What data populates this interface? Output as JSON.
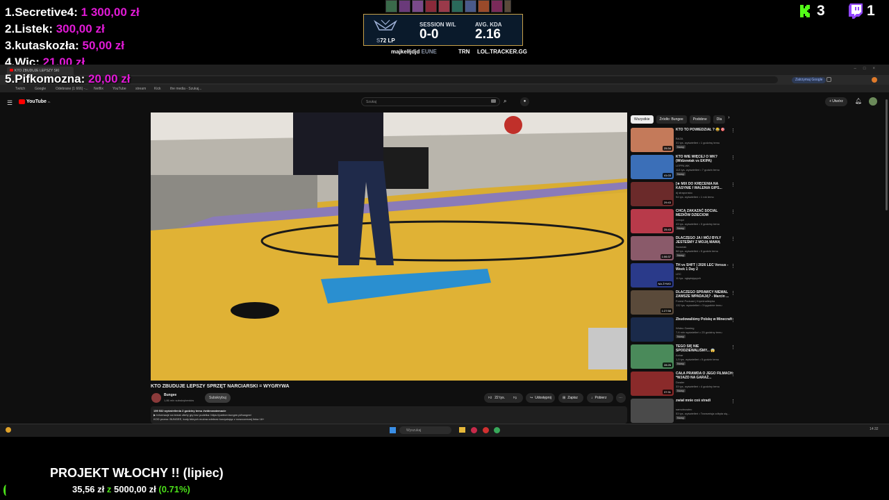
{
  "donations": [
    {
      "rank": "1.",
      "name": "Secretive4:",
      "amount": "1 300,00 zł"
    },
    {
      "rank": "2.",
      "name": "Listek:",
      "amount": "300,00 zł"
    },
    {
      "rank": "3.",
      "name": "kutaskozła:",
      "amount": "50,00 zł"
    },
    {
      "rank": "4.",
      "name": "Wic:",
      "amount": "21,00 zł"
    },
    {
      "rank": "5.",
      "name": "Pifkomozna:",
      "amount": "20,00 zł"
    }
  ],
  "platform_counts": {
    "kick": "3",
    "twitch": "1"
  },
  "hud": {
    "lp": "72 LP",
    "lp_prefix": "S",
    "session_label": "SESSION W/L",
    "session_value": "0-0",
    "kda_label": "AVG. KDA",
    "kda_value": "2.16",
    "summoner": "majkelłjdjd",
    "region": "EUNE",
    "trn": "TRN",
    "tracker": "LOL.TRACKER.GG"
  },
  "browser": {
    "tab_title": "KTO ZBUDUJE LEPSZY SKI",
    "bookmarks": [
      "Twitch",
      "Google",
      "Odebrane (1 666) -...",
      "Netflix",
      "YouTube",
      "stream",
      "Kick",
      "the media - Szukaj..."
    ],
    "profile_badge": "Zatrzymaj Google"
  },
  "youtube": {
    "logo": "YouTube",
    "logo_sup": "PL",
    "search_placeholder": "Szukaj",
    "create_label": "+ Utwórz",
    "video_title": "KTO ZBUDUJE LEPSZY SPRZĘT NARCIARSKI = WYGRYWA",
    "channel_name": "Bungee",
    "subscribers": "1,86 mln subskrybentów",
    "subscribe_label": "Subskrybuj",
    "likes": "22 tys.",
    "share_label": "Udostępnij",
    "save_label": "Zapisz",
    "download_label": "Pobierz",
    "description_line1": "159 532 wyświetlenia  2 godziny temu  #wideonatemacie",
    "description_line2": "▶ Informacje na temat oferty gry bez pudełka: https://partner.bungee.pl/bungee/",
    "description_line3": "KOD promo: BUNGEE, kody których można odebrać korzystając z nowoczesnej linka 18+",
    "chips": [
      "Wszystkie",
      "Źródło: Bungee",
      "Podobne",
      "Dla"
    ],
    "recommendations": [
      {
        "title": "KTO TO POWIEDZIAŁ ? 😂 🎯",
        "channel": "BAZA",
        "meta": "31 tys. wyświetleń • 1 godzinę temu",
        "badge": "Nowy",
        "duration": "25:34",
        "color": "#c47a5a"
      },
      {
        "title": "KTO WIE WIĘCEJ O WK? (Widzewiak vs EKIPA)",
        "channel": "LEPPA WK",
        "meta": "113 tys. wyświetleń • 7 godzin temu",
        "badge": "Nowy",
        "duration": "41:03",
        "color": "#3b6fb8"
      },
      {
        "title": "[★ MIX DO KRĘCENIA NA KASYNIE I WALENIA GIPS...",
        "channel": "dj straponsko",
        "meta": "94 tys. wyświetleń • 1 rok temu",
        "badge": "",
        "duration": "29:43",
        "color": "#6b2a2a"
      },
      {
        "title": "CHCĄ ZAKAZAĆ SOCIAL MEDIÓW DZIECIOM",
        "channel": "Lexqui",
        "meta": "43 tys. wyświetleń • 3 godziny temu",
        "badge": "Nowy",
        "duration": "25:43",
        "color": "#b83a4a"
      },
      {
        "title": "DLACZEGO JA I MÓJ BYŁY JESTEŚMY Z MOJĄ MAMĄ",
        "channel": "Nowniak",
        "meta": "58 tys. wyświetleń • 5 godzin temu",
        "badge": "Nowy",
        "duration": "1:06:37",
        "color": "#8a5a6a"
      },
      {
        "title": "TH vs SHFT | 2026 LEC Versus - Week 1 Day 2",
        "channel": "LEC",
        "meta": "11 tys. oglądających",
        "badge": "",
        "duration": "NA ŻYWO",
        "color": "#2a3a8a"
      },
      {
        "title": "DLACZEGO SPRAWCY NIEMAL ZAWSZE WPADAJĄ? - Marcin ...",
        "channel": "Forest Podcast | Kryminalistyka",
        "meta": "132 tys. wyświetleń • 3 tygodnie temu",
        "badge": "",
        "duration": "1:27:58",
        "color": "#5a4a3a"
      },
      {
        "title": "Zbudowaliśmy Polskę w Minecraft",
        "channel": "Wideo Gaming",
        "meta": "7,6 mln wyświetleń • 23 godziny temu",
        "badge": "Nowy",
        "duration": "",
        "color": "#1a2a4a"
      },
      {
        "title": "TEGO SIĘ NIE SPODZIEWALIŚMY... 😱",
        "channel": "Azbar",
        "meta": "1,5 tys. wyświetleń • 5 godzin temu",
        "badge": "Nowy",
        "duration": "28:26",
        "color": "#4a8a5a"
      },
      {
        "title": "CAŁA PRAWDA O JEGO FILMACH *WJAZD NA GARAŻ...",
        "channel": "Dwaler",
        "meta": "33 tys. wyświetleń • 4 godziny temu",
        "badge": "Nowy",
        "duration": "37:31",
        "color": "#8a2a2a"
      },
      {
        "title": "zwiał mnie coś stradi",
        "channel": "samotnowiec",
        "meta": "53 tys. wyświetleń • Transmisja odbyła się...",
        "badge": "Nowy",
        "duration": "",
        "color": "#4a4a4a"
      }
    ]
  },
  "taskbar": {
    "search_placeholder": "Wyszukaj",
    "clock": "14:32"
  },
  "goal": {
    "title": "PROJEKT WŁOCHY !! (lipiec)",
    "current": "35,56 zł",
    "separator": "z",
    "target": "5000,00 zł",
    "percent": "(0.71%)",
    "progress": 0.0071
  },
  "colors": {
    "accent_pink": "#e11ad6",
    "kick_green": "#53fc18",
    "twitch_purple": "#9146ff",
    "goal_green": "#4ce11a",
    "hud_gold": "#c8a14a"
  }
}
